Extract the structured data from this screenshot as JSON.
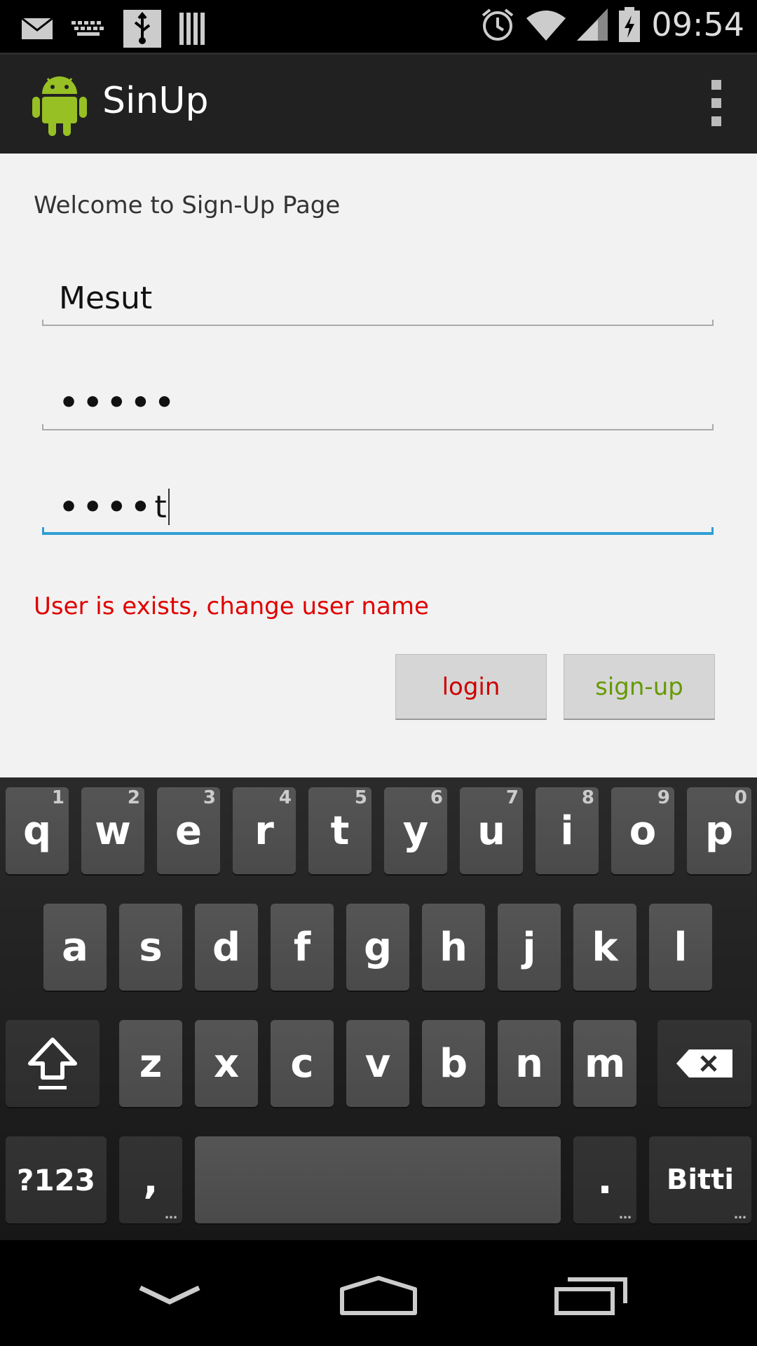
{
  "status_bar": {
    "time": "09:54",
    "left_icons": [
      "mail-icon",
      "keyboard-icon",
      "usb-icon",
      "storage-icon"
    ],
    "right_icons": [
      "alarm-icon",
      "wifi-icon",
      "signal-icon",
      "battery-charging-icon"
    ]
  },
  "action_bar": {
    "title": "SinUp",
    "menu_icon": "overflow-menu-icon"
  },
  "form": {
    "welcome": "Welcome to Sign-Up Page",
    "username_value": "Mesut",
    "password_masked": "•••••",
    "confirm_masked": "••••",
    "confirm_last_char": "t",
    "error_message": "User is exists, change user name",
    "login_label": "login",
    "signup_label": "sign-up",
    "colors": {
      "error": "#e00000",
      "login_text": "#cc0000",
      "signup_text": "#669900",
      "focus_line": "#2e9fd3"
    }
  },
  "keyboard": {
    "row1": [
      {
        "label": "q",
        "hint": "1"
      },
      {
        "label": "w",
        "hint": "2"
      },
      {
        "label": "e",
        "hint": "3"
      },
      {
        "label": "r",
        "hint": "4"
      },
      {
        "label": "t",
        "hint": "5"
      },
      {
        "label": "y",
        "hint": "6"
      },
      {
        "label": "u",
        "hint": "7"
      },
      {
        "label": "i",
        "hint": "8"
      },
      {
        "label": "o",
        "hint": "9"
      },
      {
        "label": "p",
        "hint": "0"
      }
    ],
    "row2": [
      "a",
      "s",
      "d",
      "f",
      "g",
      "h",
      "j",
      "k",
      "l"
    ],
    "row3": [
      "z",
      "x",
      "c",
      "v",
      "b",
      "n",
      "m"
    ],
    "symbols_label": "?123",
    "comma_label": ",",
    "period_label": ".",
    "done_label": "Bitti",
    "more_label": "…"
  },
  "nav_bar": {
    "icons": [
      "back-icon",
      "home-icon",
      "recents-icon"
    ]
  }
}
